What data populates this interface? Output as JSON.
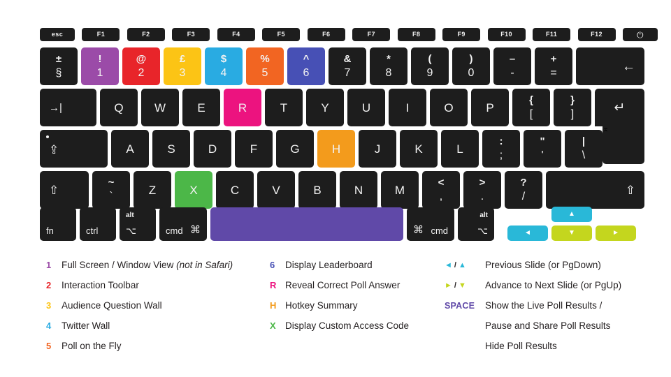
{
  "colors": {
    "key_dark": "#1d1d1d",
    "purple": "#9b4ba8",
    "red": "#e8252a",
    "yellow": "#fcc415",
    "cyan": "#29abe2",
    "orange": "#f26522",
    "indigo": "#4750b5",
    "pink": "#ec137f",
    "amber": "#f39b1c",
    "green": "#4cb748",
    "space_purple": "#6049a8",
    "arrow_cyan": "#29b8d8",
    "arrow_lime": "#c4d61e",
    "text": "#231f20"
  },
  "keyboard": {
    "function_row": [
      {
        "label": "esc",
        "name": "key-esc"
      },
      {
        "label": "F1",
        "name": "key-f1"
      },
      {
        "label": "F2",
        "name": "key-f2"
      },
      {
        "label": "F3",
        "name": "key-f3"
      },
      {
        "label": "F4",
        "name": "key-f4"
      },
      {
        "label": "F5",
        "name": "key-f5"
      },
      {
        "label": "F6",
        "name": "key-f6"
      },
      {
        "label": "F7",
        "name": "key-f7"
      },
      {
        "label": "F8",
        "name": "key-f8"
      },
      {
        "label": "F9",
        "name": "key-f9"
      },
      {
        "label": "F10",
        "name": "key-f10"
      },
      {
        "label": "F11",
        "name": "key-f11"
      },
      {
        "label": "F12",
        "name": "key-f12"
      },
      {
        "label": "⏻",
        "name": "key-power"
      }
    ],
    "number_row": {
      "section": {
        "upper": "±",
        "lower": "§",
        "name": "key-section"
      },
      "digits": [
        {
          "upper": "!",
          "lower": "1",
          "name": "key-1",
          "color": "purple"
        },
        {
          "upper": "@",
          "lower": "2",
          "name": "key-2",
          "color": "red"
        },
        {
          "upper": "£",
          "lower": "3",
          "name": "key-3",
          "color": "yellow"
        },
        {
          "upper": "$",
          "lower": "4",
          "name": "key-4",
          "color": "cyan"
        },
        {
          "upper": "%",
          "lower": "5",
          "name": "key-5",
          "color": "orange"
        },
        {
          "upper": "^",
          "lower": "6",
          "name": "key-6",
          "color": "indigo"
        },
        {
          "upper": "&",
          "lower": "7",
          "name": "key-7"
        },
        {
          "upper": "*",
          "lower": "8",
          "name": "key-8"
        },
        {
          "upper": "(",
          "lower": "9",
          "name": "key-9"
        },
        {
          "upper": ")",
          "lower": "0",
          "name": "key-0"
        },
        {
          "upper": "–",
          "lower": "-",
          "name": "key-minus"
        },
        {
          "upper": "+",
          "lower": "=",
          "name": "key-equals"
        }
      ],
      "delete": {
        "glyph": "←",
        "name": "key-delete"
      }
    },
    "qwerty_row": {
      "tab": {
        "glyph": "→|",
        "name": "key-tab"
      },
      "letters": [
        {
          "label": "Q",
          "name": "key-q"
        },
        {
          "label": "W",
          "name": "key-w"
        },
        {
          "label": "E",
          "name": "key-e"
        },
        {
          "label": "R",
          "name": "key-r",
          "color": "pink"
        },
        {
          "label": "T",
          "name": "key-t"
        },
        {
          "label": "Y",
          "name": "key-y"
        },
        {
          "label": "U",
          "name": "key-u"
        },
        {
          "label": "I",
          "name": "key-i"
        },
        {
          "label": "O",
          "name": "key-o"
        },
        {
          "label": "P",
          "name": "key-p"
        }
      ],
      "bracket_left": {
        "upper": "{",
        "lower": "[",
        "name": "key-bracket-left"
      },
      "bracket_right": {
        "upper": "}",
        "lower": "]",
        "name": "key-bracket-right"
      },
      "enter": {
        "glyph": "↵",
        "sub": "⌅",
        "name": "key-return"
      }
    },
    "home_row": {
      "caps": {
        "glyph": "⇪",
        "name": "key-caps-lock"
      },
      "letters": [
        {
          "label": "A",
          "name": "key-a"
        },
        {
          "label": "S",
          "name": "key-s"
        },
        {
          "label": "D",
          "name": "key-d"
        },
        {
          "label": "F",
          "name": "key-f"
        },
        {
          "label": "G",
          "name": "key-g"
        },
        {
          "label": "H",
          "name": "key-h",
          "color": "amber"
        },
        {
          "label": "J",
          "name": "key-j"
        },
        {
          "label": "K",
          "name": "key-k"
        },
        {
          "label": "L",
          "name": "key-l"
        }
      ],
      "semicolon": {
        "upper": ":",
        "lower": ";",
        "name": "key-semicolon"
      },
      "quote": {
        "upper": "\"",
        "lower": "'",
        "name": "key-quote"
      },
      "backslash": {
        "upper": "|",
        "lower": "\\",
        "name": "key-backslash"
      }
    },
    "shift_row": {
      "shift_left": {
        "glyph": "⇧",
        "name": "key-shift-left"
      },
      "tilde": {
        "upper": "~",
        "lower": "`",
        "name": "key-tilde"
      },
      "letters": [
        {
          "label": "Z",
          "name": "key-z"
        },
        {
          "label": "X",
          "name": "key-x",
          "color": "green"
        },
        {
          "label": "C",
          "name": "key-c"
        },
        {
          "label": "V",
          "name": "key-v"
        },
        {
          "label": "B",
          "name": "key-b"
        },
        {
          "label": "N",
          "name": "key-n"
        },
        {
          "label": "M",
          "name": "key-m"
        }
      ],
      "comma": {
        "upper": "<",
        "lower": ",",
        "name": "key-comma"
      },
      "period": {
        "upper": ">",
        "lower": ".",
        "name": "key-period"
      },
      "slash": {
        "upper": "?",
        "lower": "/",
        "name": "key-slash"
      },
      "shift_right": {
        "glyph": "⇧",
        "name": "key-shift-right"
      }
    },
    "bottom_row": {
      "fn": {
        "label": "fn",
        "name": "key-fn"
      },
      "ctrl": {
        "label": "ctrl",
        "name": "key-control"
      },
      "alt_left": {
        "label": "alt",
        "glyph": "⌥",
        "name": "key-option-left"
      },
      "cmd_left": {
        "label": "cmd",
        "glyph": "⌘",
        "name": "key-command-left"
      },
      "space": {
        "label": "",
        "name": "key-space",
        "color": "space_purple"
      },
      "cmd_right": {
        "label": "cmd",
        "glyph": "⌘",
        "name": "key-command-right"
      },
      "alt_right": {
        "label": "alt",
        "glyph": "⌥",
        "name": "key-option-right"
      },
      "arrow_up": {
        "glyph": "▲",
        "name": "key-arrow-up",
        "color": "arrow_cyan"
      },
      "arrow_left": {
        "glyph": "◄",
        "name": "key-arrow-left",
        "color": "arrow_cyan"
      },
      "arrow_down": {
        "glyph": "▼",
        "name": "key-arrow-down",
        "color": "arrow_lime"
      },
      "arrow_right": {
        "glyph": "►",
        "name": "key-arrow-right",
        "color": "arrow_lime"
      }
    }
  },
  "legend": {
    "column1": [
      {
        "key": "1",
        "color": "purple",
        "text": "Full Screen / Window View ",
        "italic": "(not in Safari)"
      },
      {
        "key": "2",
        "color": "red",
        "text": "Interaction Toolbar",
        "italic": ""
      },
      {
        "key": "3",
        "color": "yellow",
        "text": "Audience Question Wall",
        "italic": ""
      },
      {
        "key": "4",
        "color": "cyan",
        "text": "Twitter Wall",
        "italic": ""
      },
      {
        "key": "5",
        "color": "orange",
        "text": "Poll on the Fly",
        "italic": ""
      }
    ],
    "column2": [
      {
        "key": "6",
        "color": "indigo",
        "text": "Display Leaderboard"
      },
      {
        "key": "R",
        "color": "pink",
        "text": "Reveal Correct Poll Answer"
      },
      {
        "key": "H",
        "color": "amber",
        "text": "Hotkey Summary"
      },
      {
        "key": "X",
        "color": "green",
        "text": "Display Custom Access Code"
      }
    ],
    "column3": [
      {
        "key": "arrows-prev",
        "text": "Previous Slide (or PgDown)"
      },
      {
        "key": "arrows-next",
        "text": "Advance to Next Slide (or PgUp)"
      },
      {
        "key": "SPACE",
        "text": "Show the Live Poll Results /"
      },
      {
        "key": "",
        "text": "Pause and Share Poll Results"
      },
      {
        "key": "",
        "text": "Hide Poll Results"
      }
    ],
    "arrow_symbols": {
      "prev_left": "◄",
      "prev_sep": "/",
      "prev_up": "▲",
      "next_right": "►",
      "next_sep": "/",
      "next_down": "▼",
      "space_label": "SPACE"
    }
  }
}
